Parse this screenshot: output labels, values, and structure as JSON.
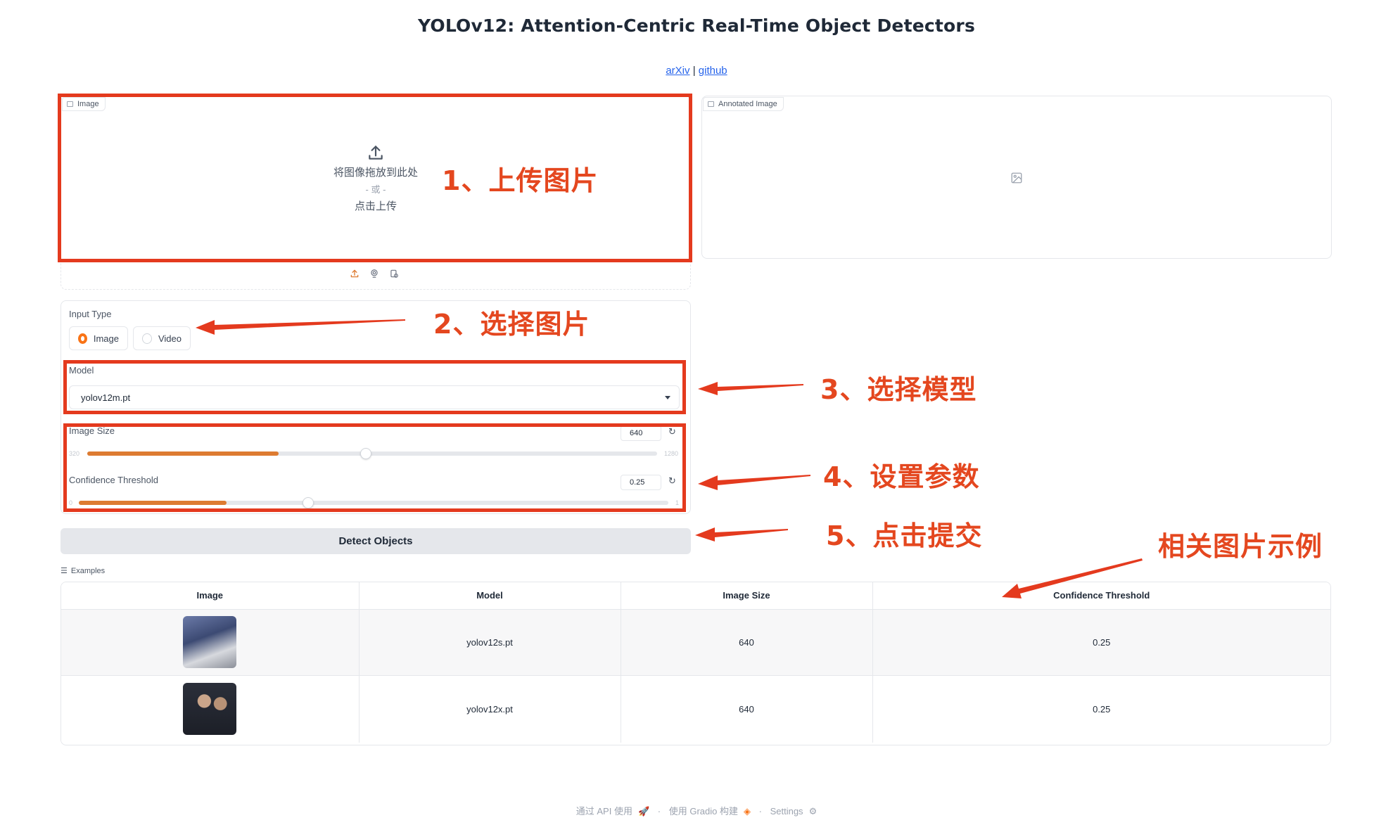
{
  "header": {
    "title": "YOLOv12: Attention-Centric Real-Time Object Detectors",
    "link_arxiv": "arXiv",
    "link_separator": "|",
    "link_github": "github"
  },
  "image_input": {
    "label": "Image",
    "drop_text": "将图像拖放到此处",
    "or_text": "- 或 -",
    "click_text": "点击上传"
  },
  "annotated_output": {
    "label": "Annotated Image"
  },
  "input_type": {
    "label": "Input Type",
    "options": [
      "Image",
      "Video"
    ],
    "selected": "Image"
  },
  "model": {
    "label": "Model",
    "value": "yolov12m.pt"
  },
  "image_size": {
    "label": "Image Size",
    "value": "640",
    "min": "320",
    "max": "1280"
  },
  "confidence": {
    "label": "Confidence Threshold",
    "value": "0.25",
    "min": "0",
    "max": "1"
  },
  "submit": {
    "label": "Detect Objects"
  },
  "examples": {
    "label": "Examples",
    "columns": [
      "Image",
      "Model",
      "Image Size",
      "Confidence Threshold"
    ],
    "rows": [
      {
        "model": "yolov12s.pt",
        "image_size": "640",
        "confidence": "0.25"
      },
      {
        "model": "yolov12x.pt",
        "image_size": "640",
        "confidence": "0.25"
      }
    ]
  },
  "annotations": {
    "step1": "1、上传图片",
    "step2": "2、选择图片",
    "step3": "3、选择模型",
    "step4": "4、设置参数",
    "step5": "5、点击提交",
    "examples_note": "相关图片示例",
    "color": "#e43a1e"
  },
  "footer": {
    "api": "通过 API 使用",
    "gradio": "使用 Gradio 构建",
    "settings": "Settings",
    "dot": "·"
  },
  "theme": {
    "accent": "#dd7b31",
    "link": "#2563eb"
  }
}
